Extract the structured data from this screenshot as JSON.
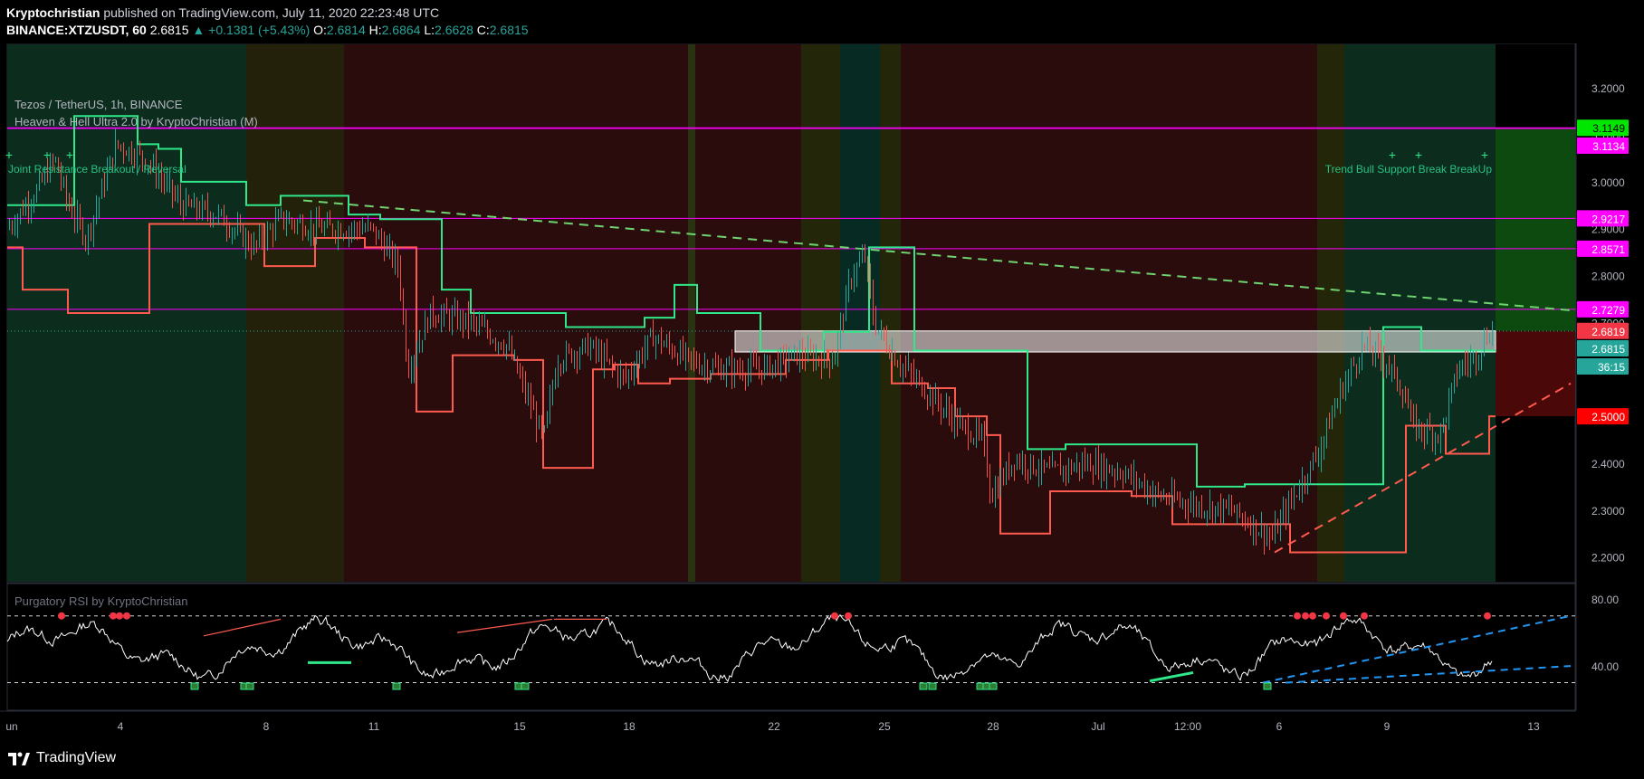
{
  "header": {
    "author": "Kryptochristian",
    "published": " published on TradingView.com, July 11, 2020 22:23:48 UTC",
    "symbol": "BINANCE:XTZUSDT, 60",
    "last": "2.6815",
    "change": "▲ +0.1381 (+5.43%)",
    "o_label": "O:",
    "o": "2.6814",
    "h_label": "H:",
    "h": "2.6864",
    "l_label": "L:",
    "l": "2.6628",
    "c_label": "C:",
    "c": "2.6815"
  },
  "legend": {
    "pair": "Tezos / TetherUS, 1h, BINANCE",
    "indicator": "Heaven & Hell Ultra 2.0 by KryptoChristian (M)",
    "rsi": "Purgatory RSI by KryptoChristian"
  },
  "signals": {
    "left": "Joint Resistance Breakout / Reversal",
    "right": "Trend Bull Support Break BreakUp"
  },
  "price_labels": [
    {
      "text": "3.1149",
      "bg": "#00e600",
      "fg": "#000"
    },
    {
      "text": "3.1134",
      "bg": "#ff00ff",
      "fg": "#fff"
    },
    {
      "text": "2.9217",
      "bg": "#ff00ff",
      "fg": "#fff"
    },
    {
      "text": "2.8571",
      "bg": "#ff00ff",
      "fg": "#fff"
    },
    {
      "text": "2.7279",
      "bg": "#ff00ff",
      "fg": "#fff"
    },
    {
      "text": "2.6819",
      "bg": "#f23645",
      "fg": "#fff"
    },
    {
      "text": "2.6815",
      "bg": "#26a69a",
      "fg": "#fff"
    },
    {
      "text": "36:15",
      "bg": "#26a69a",
      "fg": "#fff"
    },
    {
      "text": "2.5000",
      "bg": "#ff0000",
      "fg": "#fff"
    }
  ],
  "time_labels": [
    "un",
    "4",
    "8",
    "11",
    "15",
    "18",
    "22",
    "25",
    "28",
    "Jul",
    "12:00",
    "6",
    "9",
    "13"
  ],
  "footer": {
    "brand": "TradingView"
  },
  "colors": {
    "up": "#26a69a",
    "down": "#ef5350",
    "heaven": "#2ee88a",
    "hell": "#ff5a4e",
    "magenta": "#ff00ff",
    "bg": "#000000"
  },
  "chart_data": {
    "type": "line",
    "title": "Tezos / TetherUS, 1h, BINANCE",
    "x": [
      "Jun 1",
      "Jun 4",
      "Jun 8",
      "Jun 11",
      "Jun 15",
      "Jun 18",
      "Jun 22",
      "Jun 25",
      "Jun 28",
      "Jul 1",
      "Jul 4",
      "Jul 6",
      "Jul 9",
      "Jul 11"
    ],
    "series": [
      {
        "values": [
          2.95,
          3.07,
          2.92,
          2.86,
          2.62,
          2.66,
          2.67,
          2.66,
          2.42,
          2.4,
          2.31,
          2.25,
          2.62,
          2.68
        ]
      }
    ],
    "ylim": [
      2.18,
      3.26
    ],
    "y_ticks": [
      2.2,
      2.3,
      2.4,
      2.5,
      2.6,
      2.7,
      2.8,
      2.9,
      3.0,
      3.1,
      3.2
    ],
    "horizontal_levels": [
      3.1149,
      3.1134,
      2.9217,
      2.8571,
      2.7279,
      2.5
    ],
    "rsi": {
      "ylim": [
        20,
        85
      ],
      "y_ticks": [
        40.0,
        80.0
      ],
      "overbought": 70,
      "oversold": 30
    }
  },
  "axis": {
    "y_ticks": [
      "2.2000",
      "2.3000",
      "2.4000",
      "2.5000",
      "2.6000",
      "2.7000",
      "2.8000",
      "2.9000",
      "3.0000",
      "3.1000",
      "3.2000"
    ],
    "rsi_ticks": [
      "40.00",
      "80.00"
    ]
  }
}
